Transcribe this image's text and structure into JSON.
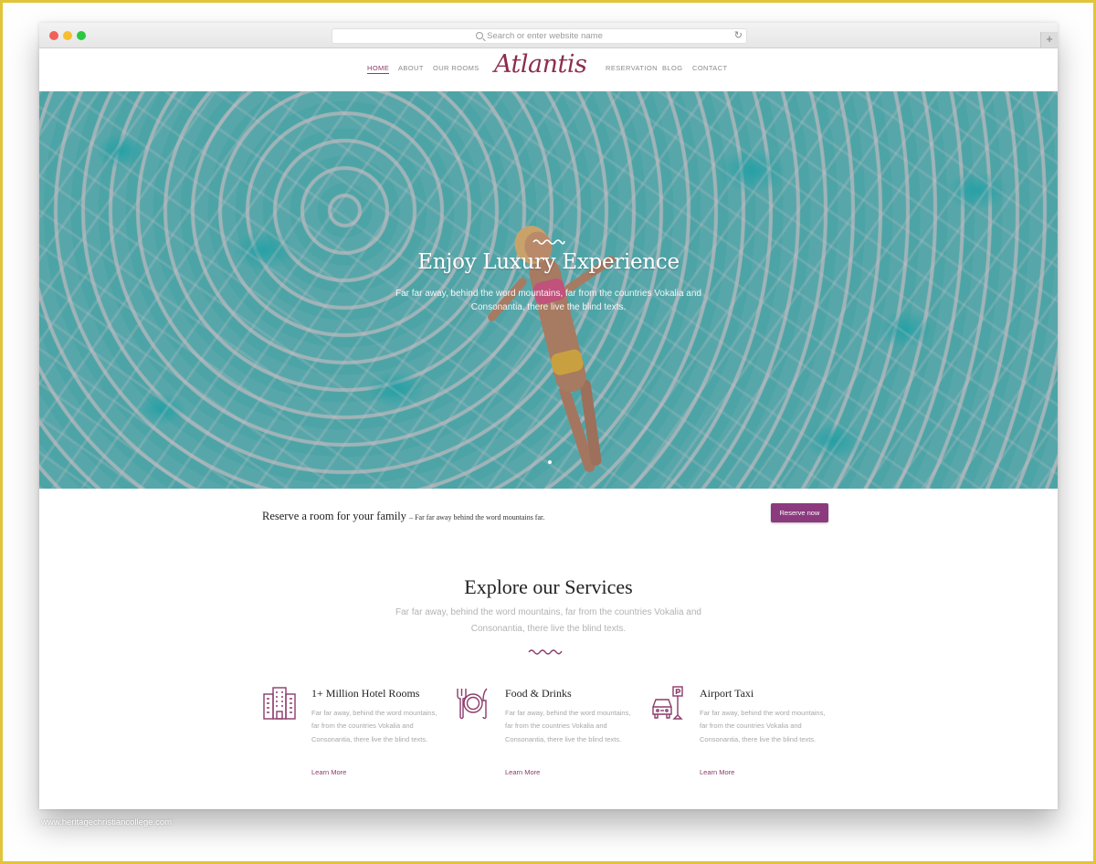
{
  "browser": {
    "url_placeholder": "Search or enter website name",
    "reload_icon": "reload-icon",
    "newtab_label": "+"
  },
  "nav": {
    "logo": "Atlantis",
    "left_items": [
      {
        "label": "HOME",
        "active": true
      },
      {
        "label": "ABOUT",
        "active": false
      },
      {
        "label": "OUR ROOMS",
        "active": false
      }
    ],
    "right_items": [
      {
        "label": "RESERVATION",
        "active": false
      },
      {
        "label": "BLOG",
        "active": false
      },
      {
        "label": "CONTACT",
        "active": false
      }
    ]
  },
  "hero": {
    "title": "Enjoy Luxury Experience",
    "subtitle_line1": "Far far away, behind the word mountains, far from the countries Vokalia and",
    "subtitle_line2": "Consonantia, there live the blind texts.",
    "active_slide": 1
  },
  "reserve": {
    "headline": "Reserve a room for your family",
    "tagline": "– Far far away behind the word mountains far.",
    "button_label": "Reserve now"
  },
  "services": {
    "title": "Explore our Services",
    "subtitle_line1": "Far far away, behind the word mountains, far from the countries Vokalia and",
    "subtitle_line2": "Consonantia, there live the blind texts.",
    "items": [
      {
        "icon": "hotel-building-icon",
        "title": "1+ Million Hotel Rooms",
        "text": "Far far away, behind the word mountains, far from the countries Vokalia and Consonantia, there live the blind texts.",
        "link": "Learn More"
      },
      {
        "icon": "plate-cutlery-icon",
        "title": "Food & Drinks",
        "text": "Far far away, behind the word mountains, far from the countries Vokalia and Consonantia, there live the blind texts.",
        "link": "Learn More"
      },
      {
        "icon": "taxi-parking-icon",
        "title": "Airport Taxi",
        "text": "Far far away, behind the word mountains, far from the countries Vokalia and Consonantia, there live the blind texts.",
        "link": "Learn More"
      }
    ]
  },
  "colors": {
    "accent": "#8c3a7e",
    "logo": "#8c2e50",
    "frame": "#e2c43a"
  },
  "watermark": "www.heritagechristiancollege.com"
}
